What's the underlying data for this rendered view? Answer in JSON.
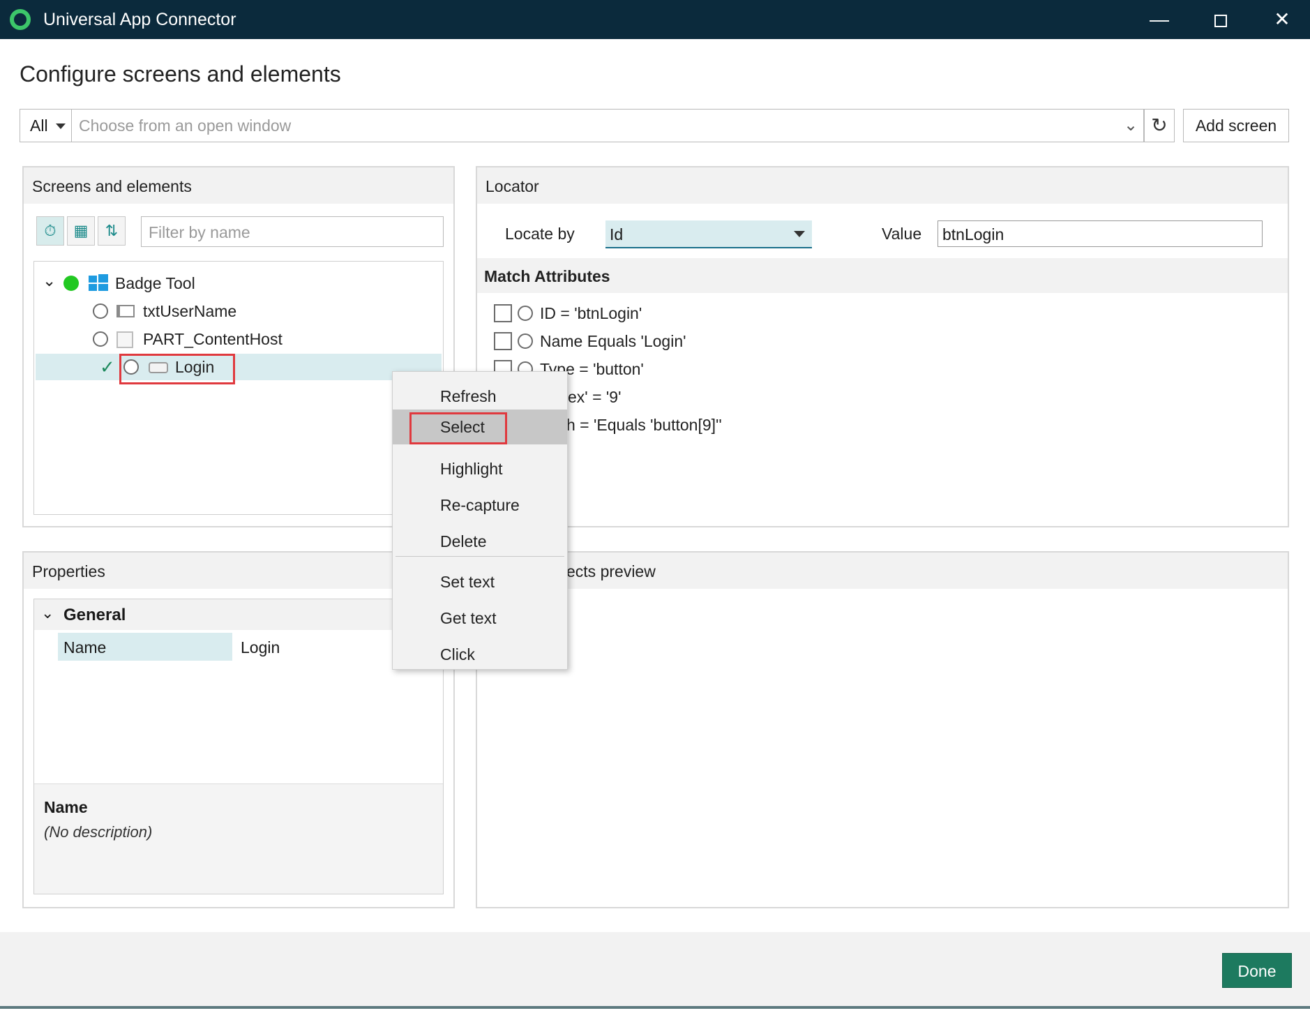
{
  "window": {
    "title": "Universal App Connector",
    "controls": [
      "minimize",
      "maximize",
      "close"
    ]
  },
  "heading": "Configure screens and elements",
  "selector": {
    "scope": "All",
    "placeholder": "Choose from an open window",
    "add_screen_label": "Add screen"
  },
  "screens_panel": {
    "title": "Screens and elements",
    "filter_placeholder": "Filter by name",
    "tree": {
      "root": "Badge Tool",
      "children": [
        "txtUserName",
        "PART_ContentHost",
        "Login"
      ],
      "selected": "Login"
    }
  },
  "locator_panel": {
    "title": "Locator",
    "locate_by_label": "Locate by",
    "locate_by_value": "Id",
    "value_label": "Value",
    "value": "btnLogin",
    "match_attributes_title": "Match Attributes",
    "attributes": [
      "ID = 'btnLogin'",
      "Name Equals 'Login'",
      "Type = 'button'",
      "ex' = '9'",
      "h = 'Equals 'button[9]''"
    ]
  },
  "properties_panel": {
    "title": "Properties",
    "group": "General",
    "name_label": "Name",
    "name_value": "Login",
    "desc_title": "Name",
    "desc_text": "(No description)"
  },
  "effects_panel": {
    "title_visible": "ects preview"
  },
  "context_menu": {
    "items": [
      "Refresh",
      "Select",
      "Highlight",
      "Re-capture",
      "Delete",
      "Set text",
      "Get text",
      "Click"
    ],
    "highlighted": "Select"
  },
  "footer": {
    "done_label": "Done"
  },
  "colors": {
    "titlebar": "#0b2a3c",
    "accent_green": "#1d7a5f",
    "selection": "#d9ecef",
    "annotation_red": "#e0393e",
    "status_green": "#22c822"
  },
  "icons": [
    "app-logo-icon",
    "refresh-icon",
    "chevron-down-icon",
    "history-icon",
    "list-icon",
    "sort-icon",
    "windows-icon",
    "checkmark-icon"
  ]
}
